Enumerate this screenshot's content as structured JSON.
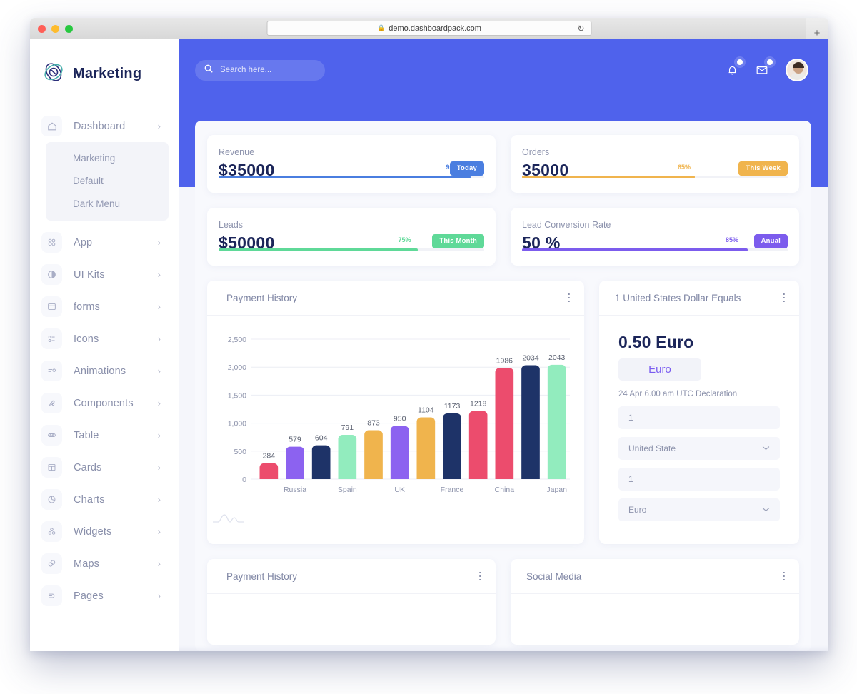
{
  "browser": {
    "url": "demo.dashboardpack.com",
    "lock_icon": "lock-icon",
    "reload_icon": "reload-icon",
    "newtab_label": "+"
  },
  "sidebar": {
    "brand": "Marketing",
    "items": [
      {
        "label": "Dashboard",
        "icon": "home-icon",
        "caret": "›"
      },
      {
        "label": "App",
        "icon": "grid-icon",
        "caret": "›"
      },
      {
        "label": "UI Kits",
        "icon": "contrast-icon",
        "caret": "›"
      },
      {
        "label": "forms",
        "icon": "form-icon",
        "caret": "›"
      },
      {
        "label": "Icons",
        "icon": "list-icon",
        "caret": "›"
      },
      {
        "label": "Animations",
        "icon": "motion-icon",
        "caret": "›"
      },
      {
        "label": "Components",
        "icon": "brush-icon",
        "caret": "›"
      },
      {
        "label": "Table",
        "icon": "table-icon",
        "caret": "›"
      },
      {
        "label": "Cards",
        "icon": "cards-icon",
        "caret": "›"
      },
      {
        "label": "Charts",
        "icon": "pie-chart-icon",
        "caret": "›"
      },
      {
        "label": "Widgets",
        "icon": "widgets-icon",
        "caret": "›"
      },
      {
        "label": "Maps",
        "icon": "map-icon",
        "caret": "›"
      },
      {
        "label": "Pages",
        "icon": "pages-icon",
        "caret": "›"
      }
    ],
    "submenu": [
      {
        "label": "Marketing"
      },
      {
        "label": "Default"
      },
      {
        "label": "Dark Menu"
      }
    ]
  },
  "topbar": {
    "search_placeholder": "Search here...",
    "search_icon": "search-icon",
    "bell_icon": "bell-icon",
    "mail_icon": "envelope-icon",
    "avatar": "user-avatar"
  },
  "stats": [
    {
      "label": "Revenue",
      "value": "$35000",
      "badge": "Today",
      "percent": "95%",
      "pct_num": 95,
      "color": "#4a7ee0"
    },
    {
      "label": "Orders",
      "value": "35000",
      "badge": "This Week",
      "percent": "65%",
      "pct_num": 65,
      "color": "#f0b44d"
    },
    {
      "label": "Leads",
      "value": "$50000",
      "badge": "This Month",
      "percent": "75%",
      "pct_num": 75,
      "color": "#5fd998"
    },
    {
      "label": "Lead Conversion Rate",
      "value": "50 %",
      "badge": "Anual",
      "percent": "85%",
      "pct_num": 85,
      "color": "#7c5ced"
    }
  ],
  "payment_history_card": {
    "title": "Payment History",
    "menu_icon": "kebab-menu-icon"
  },
  "currency_card": {
    "title": "1 United States Dollar Equals",
    "menu_icon": "kebab-menu-icon",
    "rate": "0.50 Euro",
    "chip": "Euro",
    "note": "24 Apr 6.00 am UTC Declaration",
    "amount_from": "1",
    "country_from": "United State",
    "amount_to": "1",
    "country_to": "Euro",
    "chevron_icon": "chevron-down-icon"
  },
  "bottom_cards": [
    {
      "title": "Payment History",
      "menu_icon": "kebab-menu-icon"
    },
    {
      "title": "Social Media",
      "menu_icon": "kebab-menu-icon"
    }
  ],
  "chart_data": {
    "type": "bar",
    "title": "Payment History",
    "categories": [
      "",
      "Russia",
      "",
      "Spain",
      "",
      "UK",
      "",
      "France",
      "",
      "China",
      "",
      "Japan"
    ],
    "tick_labels": [
      "Russia",
      "Spain",
      "UK",
      "France",
      "China",
      "Japan"
    ],
    "values": [
      284,
      579,
      604,
      791,
      873,
      950,
      1104,
      1173,
      1218,
      1986,
      2034,
      2043
    ],
    "colors": [
      "#ec4c6d",
      "#8c62f0",
      "#1e3368",
      "#92ecbe",
      "#f0b44d",
      "#8c62f0",
      "#f0b44d",
      "#1e3368",
      "#ec4c6d",
      "#ec4c6d",
      "#1e3368",
      "#92ecbe"
    ],
    "ylim": [
      0,
      2500
    ],
    "yticks": [
      0,
      500,
      1000,
      1500,
      2000,
      2500
    ],
    "ytick_labels": [
      "0",
      "500",
      "1,000",
      "1,500",
      "2,000",
      "2,500"
    ],
    "xlabel": "",
    "ylabel": "",
    "grid": true,
    "data_labels": true,
    "legend": "none"
  }
}
